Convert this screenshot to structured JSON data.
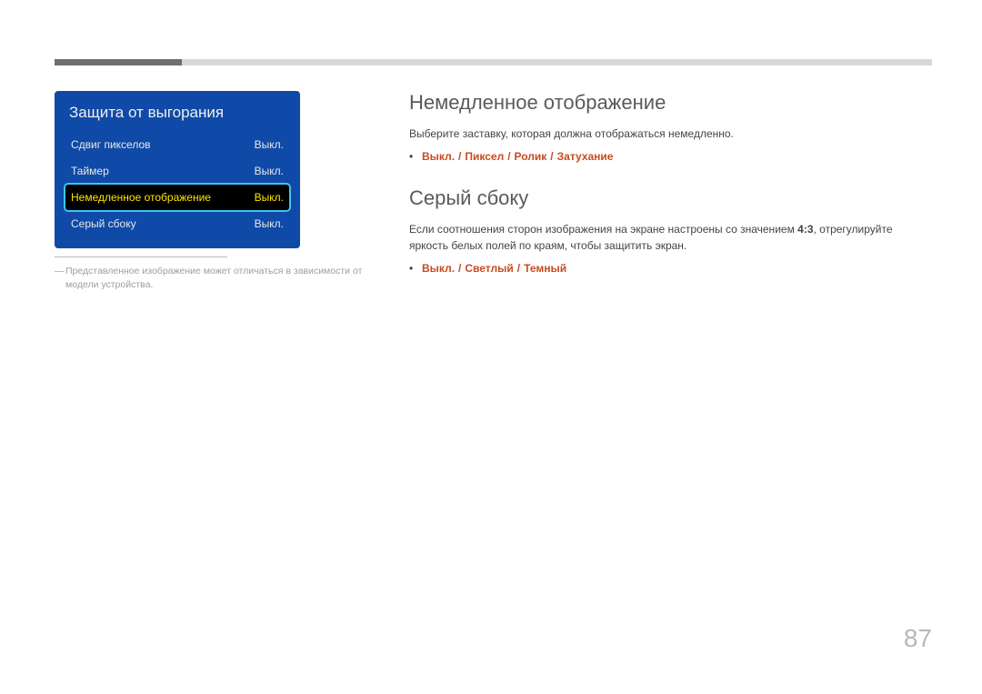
{
  "osd": {
    "title": "Защита от выгорания",
    "rows": [
      {
        "label": "Сдвиг пикселов",
        "value": "Выкл."
      },
      {
        "label": "Таймер",
        "value": "Выкл."
      },
      {
        "label": "Немедленное отображение",
        "value": "Выкл."
      },
      {
        "label": "Серый сбоку",
        "value": "Выкл."
      }
    ],
    "selected_index": 2
  },
  "disclaimer": "Представленное изображение может отличаться в зависимости от модели устройства.",
  "sections": [
    {
      "heading": "Немедленное отображение",
      "body": "Выберите заставку, которая должна отображаться немедленно.",
      "options": [
        "Выкл.",
        "Пиксел",
        "Ролик",
        "Затухание"
      ]
    },
    {
      "heading": "Серый сбоку",
      "body_pre": "Если соотношения сторон изображения на экране настроены со значением ",
      "body_bold": "4:3",
      "body_post": ", отрегулируйте яркость белых полей по краям, чтобы защитить экран.",
      "options": [
        "Выкл.",
        "Светлый",
        "Темный"
      ]
    }
  ],
  "page_number": "87"
}
